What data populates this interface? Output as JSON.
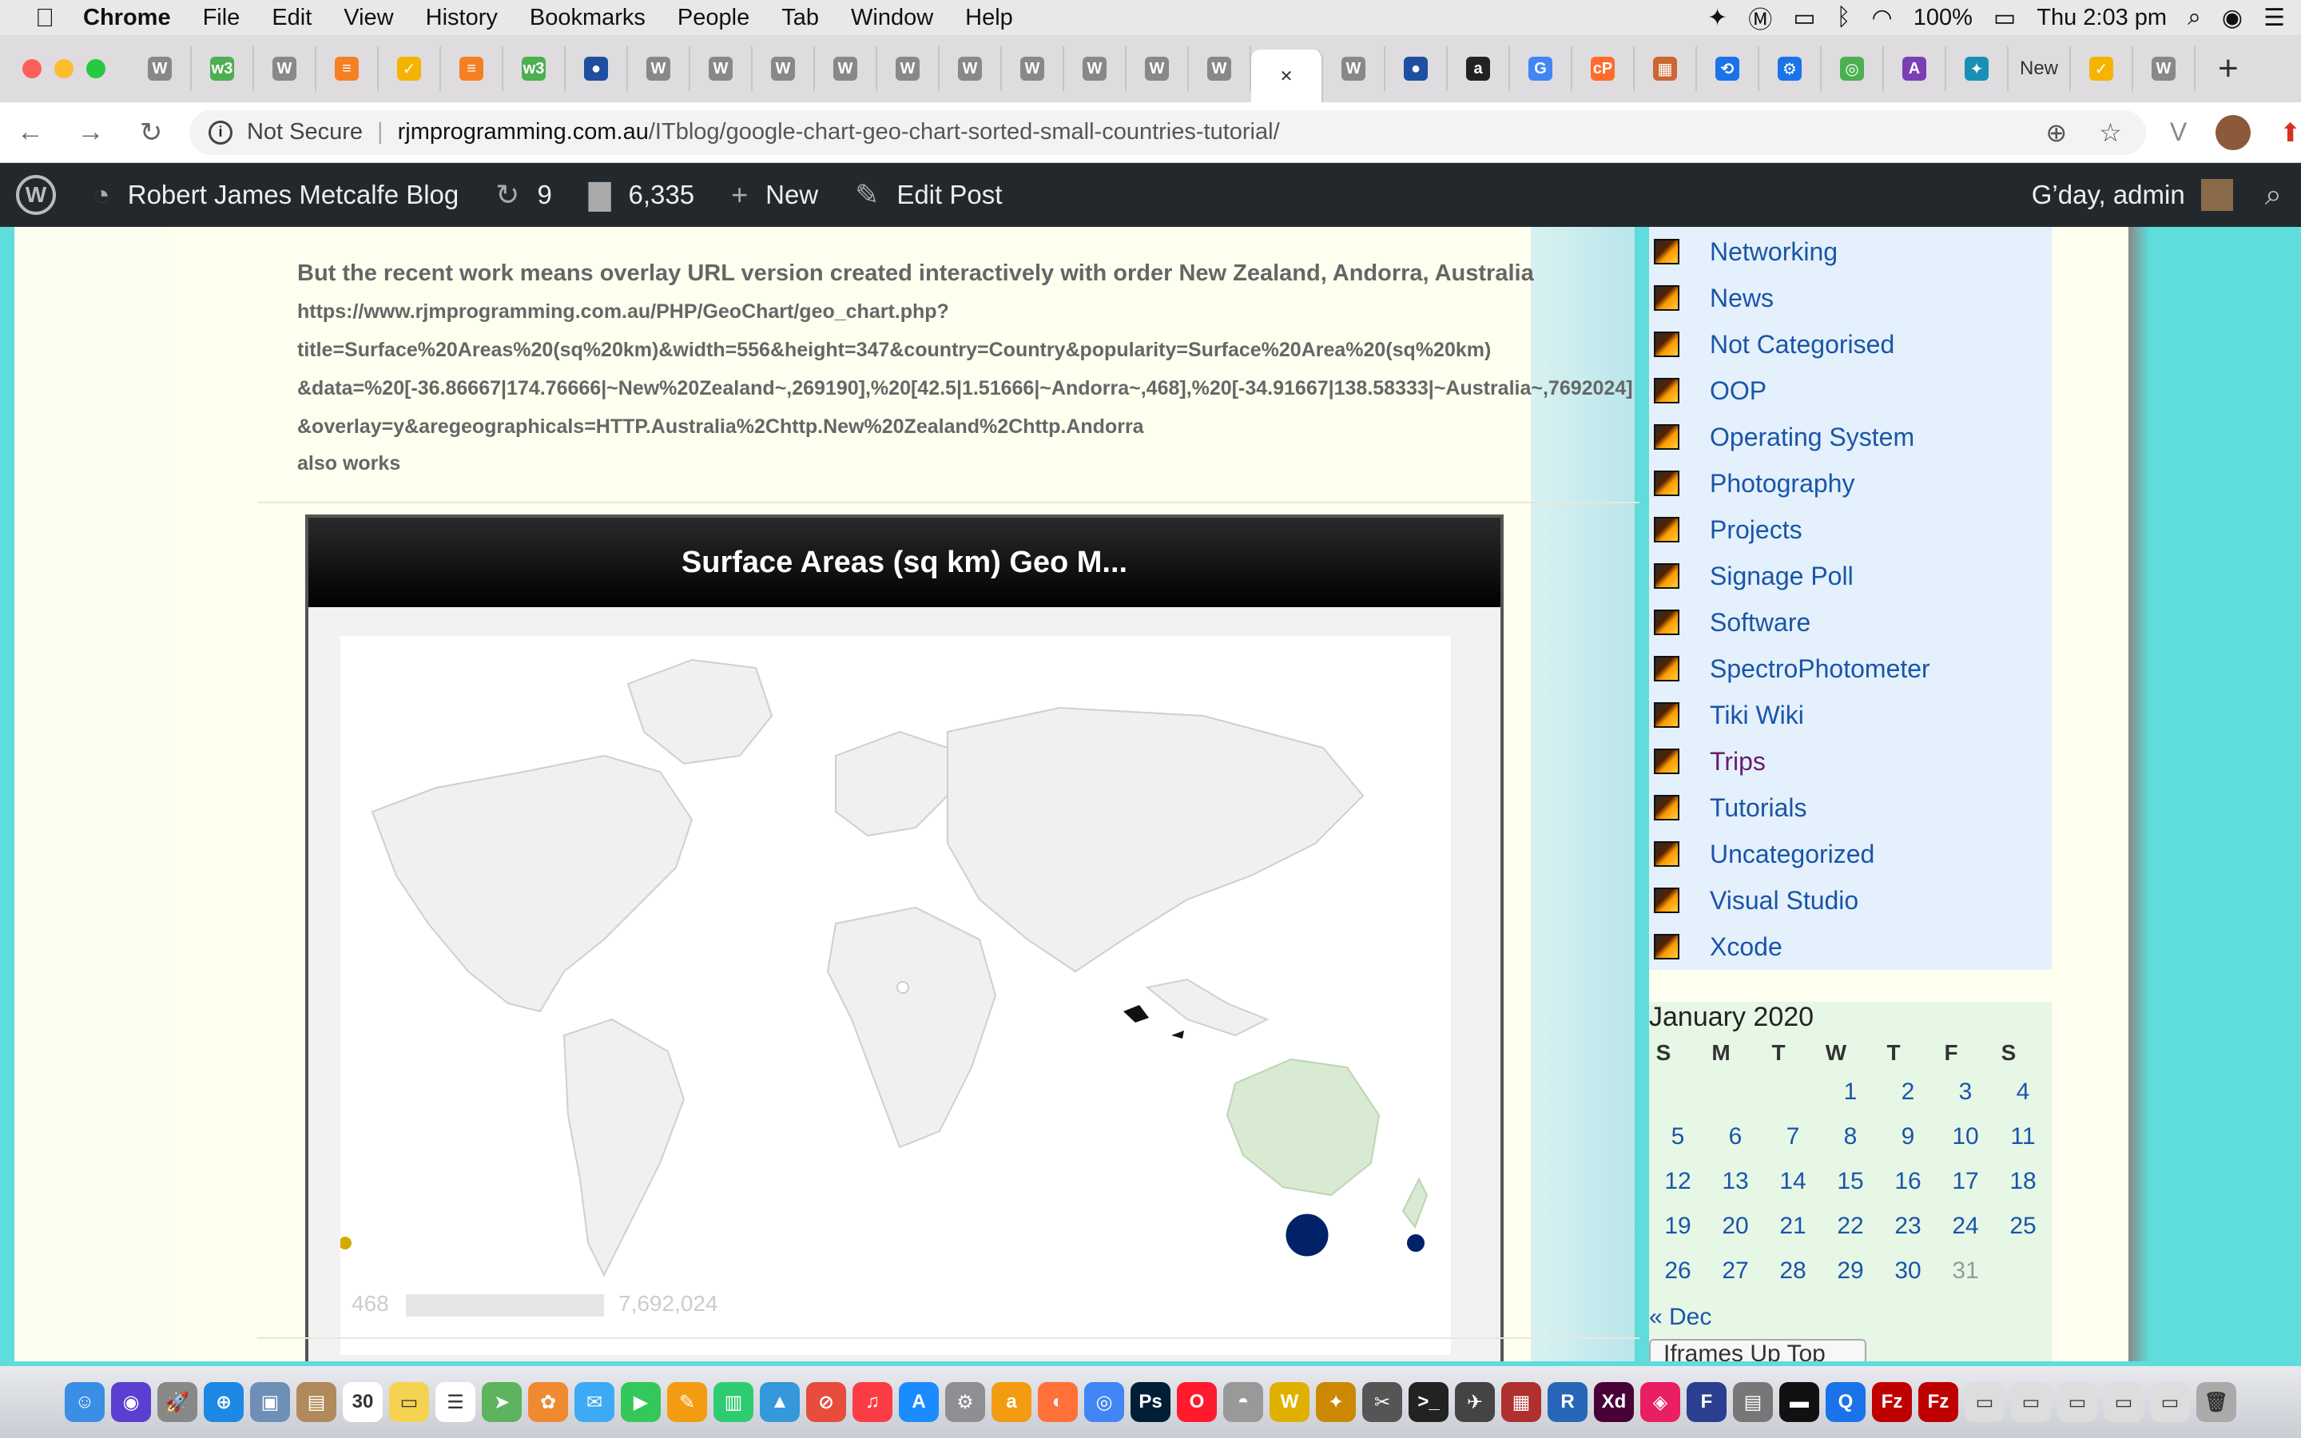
{
  "menubar": {
    "apple": "",
    "items": [
      "Chrome",
      "File",
      "Edit",
      "View",
      "History",
      "Bookmarks",
      "People",
      "Tab",
      "Window",
      "Help"
    ],
    "battery": "100%",
    "clock": "Thu 2:03 pm"
  },
  "tabs": {
    "new_tab_label": "+",
    "items": [
      {
        "icon": "wordpress-icon",
        "color": "#888888",
        "glyph": "W"
      },
      {
        "icon": "w3-icon",
        "color": "#4caf50",
        "glyph": "w3"
      },
      {
        "icon": "wordpress-icon",
        "color": "#888888",
        "glyph": "W"
      },
      {
        "icon": "stackoverflow-icon",
        "color": "#f48024",
        "glyph": "≡"
      },
      {
        "icon": "check-icon",
        "color": "#f5b400",
        "glyph": "✓"
      },
      {
        "icon": "stackoverflow-icon",
        "color": "#f48024",
        "glyph": "≡"
      },
      {
        "icon": "w3-icon",
        "color": "#4caf50",
        "glyph": "w3"
      },
      {
        "icon": "blue-circle-icon",
        "color": "#1e4fa0",
        "glyph": "●"
      },
      {
        "icon": "wordpress-icon",
        "color": "#888888",
        "glyph": "W"
      },
      {
        "icon": "wordpress-icon",
        "color": "#888888",
        "glyph": "W"
      },
      {
        "icon": "wordpress-icon",
        "color": "#888888",
        "glyph": "W"
      },
      {
        "icon": "wordpress-icon",
        "color": "#888888",
        "glyph": "W"
      },
      {
        "icon": "wordpress-icon",
        "color": "#888888",
        "glyph": "W"
      },
      {
        "icon": "wordpress-icon",
        "color": "#888888",
        "glyph": "W"
      },
      {
        "icon": "wordpress-icon",
        "color": "#888888",
        "glyph": "W"
      },
      {
        "icon": "wordpress-icon",
        "color": "#888888",
        "glyph": "W"
      },
      {
        "icon": "wordpress-icon",
        "color": "#888888",
        "glyph": "W"
      },
      {
        "icon": "wordpress-icon",
        "color": "#888888",
        "glyph": "W"
      },
      {
        "icon": "active-tab-close-icon",
        "color": "#ffffff",
        "glyph": "✕",
        "active": true
      },
      {
        "icon": "wordpress-icon",
        "color": "#888888",
        "glyph": "W"
      },
      {
        "icon": "blue-circle-icon",
        "color": "#1e4fa0",
        "glyph": "●"
      },
      {
        "icon": "amazon-icon",
        "color": "#222222",
        "glyph": "a"
      },
      {
        "icon": "google-icon",
        "color": "#4285f4",
        "glyph": "G"
      },
      {
        "icon": "cpanel-icon",
        "color": "#ff6c2c",
        "glyph": "cP"
      },
      {
        "icon": "image-icon",
        "color": "#cc6633",
        "glyph": "▦"
      },
      {
        "icon": "history-icon",
        "color": "#1a73e8",
        "glyph": "⟲"
      },
      {
        "icon": "settings-icon",
        "color": "#1a73e8",
        "glyph": "⚙"
      },
      {
        "icon": "green-app-icon",
        "color": "#4caf50",
        "glyph": "◎"
      },
      {
        "icon": "purple-app-icon",
        "color": "#7b3fb5",
        "glyph": "A"
      },
      {
        "icon": "bird-icon",
        "color": "#1a8fb5",
        "glyph": "✦"
      },
      {
        "icon": "text-tab-icon",
        "color": "#dedcdf",
        "glyph": "New"
      },
      {
        "icon": "check-icon",
        "color": "#f5b400",
        "glyph": "✓"
      },
      {
        "icon": "wordpress-icon",
        "color": "#888888",
        "glyph": "W"
      }
    ]
  },
  "omnibox": {
    "security_label": "Not Secure",
    "url_host": "rjmprogramming.com.au",
    "url_path": "/ITblog/google-chart-geo-chart-sorted-small-countries-tutorial/"
  },
  "adminbar": {
    "site_name": "Robert James Metcalfe Blog",
    "updates_count": "9",
    "comments_count": "6,335",
    "new_label": "New",
    "edit_label": "Edit Post",
    "greeting": "G’day, admin"
  },
  "post": {
    "heading": "But the recent work means overlay URL version created interactively with order New Zealand, Andorra, Australia",
    "url_lines": [
      "https://www.rjmprogramming.com.au/PHP/GeoChart/geo_chart.php?",
      "title=Surface%20Areas%20(sq%20km)&width=556&height=347&country=Country&popularity=Surface%20Area%20(sq%20km)",
      "&data=%20[-36.86667|174.76666|~New%20Zealand~,269190],%20[42.5|1.51666|~Andorra~,468],%20[-34.91667|138.58333|~Australia~,7692024]",
      "&overlay=y&aregeographicals=HTTP.Australia%2Chttp.New%20Zealand%2Chttp.Andorra"
    ],
    "also_works": "also works"
  },
  "chart_data": {
    "type": "geo",
    "title": "Surface Areas (sq km) Geo M...",
    "legend_min": "468",
    "legend_max": "7,692,024",
    "colors": {
      "shaded_country": "#d9ead3",
      "land": "#f0f0f0",
      "border": "#cfcfcf",
      "ocean": "#ffffff"
    }
  },
  "sidebar": {
    "categories": [
      {
        "label": "Networking"
      },
      {
        "label": "News"
      },
      {
        "label": "Not Categorised"
      },
      {
        "label": "OOP"
      },
      {
        "label": "Operating System"
      },
      {
        "label": "Photography"
      },
      {
        "label": "Projects"
      },
      {
        "label": "Signage Poll"
      },
      {
        "label": "Software"
      },
      {
        "label": "SpectroPhotometer"
      },
      {
        "label": "Tiki Wiki"
      },
      {
        "label": "Trips",
        "visited": true
      },
      {
        "label": "Tutorials"
      },
      {
        "label": "Uncategorized"
      },
      {
        "label": "Visual Studio"
      },
      {
        "label": "Xcode"
      }
    ],
    "calendar": {
      "title": "January 2020",
      "dow": [
        "S",
        "M",
        "T",
        "W",
        "T",
        "F",
        "S"
      ],
      "weeks": [
        [
          "",
          "",
          "",
          "1",
          "2",
          "3",
          "4"
        ],
        [
          "5",
          "6",
          "7",
          "8",
          "9",
          "10",
          "11"
        ],
        [
          "12",
          "13",
          "14",
          "15",
          "16",
          "17",
          "18"
        ],
        [
          "19",
          "20",
          "21",
          "22",
          "23",
          "24",
          "25"
        ],
        [
          "26",
          "27",
          "28",
          "29",
          "30",
          "31",
          ""
        ]
      ],
      "unlinked_days": [
        "31"
      ],
      "prev_label": "« Dec",
      "button_label": "Iframes Up Top"
    }
  },
  "dock": {
    "apps": [
      {
        "name": "finder-icon",
        "color": "#3a8ee6",
        "glyph": "☺"
      },
      {
        "name": "siri-icon",
        "color": "#5a3fd1",
        "glyph": "◉"
      },
      {
        "name": "launchpad-icon",
        "color": "#888888",
        "glyph": "🚀"
      },
      {
        "name": "safari-icon",
        "color": "#1e88e5",
        "glyph": "⊕"
      },
      {
        "name": "preview-icon",
        "color": "#6d8fb6",
        "glyph": "▣"
      },
      {
        "name": "contacts-icon",
        "color": "#b08a5a",
        "glyph": "▤"
      },
      {
        "name": "calendar-icon",
        "color": "#ffffff",
        "glyph": "30"
      },
      {
        "name": "notes-icon",
        "color": "#f5d251",
        "glyph": "▭"
      },
      {
        "name": "reminders-icon",
        "color": "#ffffff",
        "glyph": "☰"
      },
      {
        "name": "maps-icon",
        "color": "#5eb45e",
        "glyph": "➤"
      },
      {
        "name": "photos-icon",
        "color": "#f08a30",
        "glyph": "✿"
      },
      {
        "name": "messages-icon",
        "color": "#3ea9f5",
        "glyph": "✉"
      },
      {
        "name": "facetime-icon",
        "color": "#34c759",
        "glyph": "▶"
      },
      {
        "name": "pages-icon",
        "color": "#f39c12",
        "glyph": "✎"
      },
      {
        "name": "numbers-icon",
        "color": "#2ecc71",
        "glyph": "▥"
      },
      {
        "name": "keynote-icon",
        "color": "#3498db",
        "glyph": "▲"
      },
      {
        "name": "news-icon",
        "color": "#e74c3c",
        "glyph": "⊘"
      },
      {
        "name": "music-icon",
        "color": "#fc3c44",
        "glyph": "♫"
      },
      {
        "name": "appstore-icon",
        "color": "#1a8cff",
        "glyph": "A"
      },
      {
        "name": "system-preferences-icon",
        "color": "#8e8e93",
        "glyph": "⚙"
      },
      {
        "name": "app-icon",
        "color": "#f39c12",
        "glyph": "a"
      },
      {
        "name": "firefox-icon",
        "color": "#ff7139",
        "glyph": "◐"
      },
      {
        "name": "chrome-icon",
        "color": "#4285f4",
        "glyph": "◎"
      },
      {
        "name": "photoshop-icon",
        "color": "#001e36",
        "glyph": "Ps"
      },
      {
        "name": "opera-icon",
        "color": "#ff1b2d",
        "glyph": "O"
      },
      {
        "name": "elephant-icon",
        "color": "#999999",
        "glyph": "◓"
      },
      {
        "name": "app-icon",
        "color": "#e0b000",
        "glyph": "W"
      },
      {
        "name": "app-icon",
        "color": "#cc8800",
        "glyph": "✦"
      },
      {
        "name": "app-icon",
        "color": "#555555",
        "glyph": "✂"
      },
      {
        "name": "terminal-icon",
        "color": "#222222",
        "glyph": ">_"
      },
      {
        "name": "app-icon",
        "color": "#444444",
        "glyph": "✈"
      },
      {
        "name": "app-icon",
        "color": "#b03030",
        "glyph": "▦"
      },
      {
        "name": "r-icon",
        "color": "#2766b8",
        "glyph": "R"
      },
      {
        "name": "xd-icon",
        "color": "#470137",
        "glyph": "Xd"
      },
      {
        "name": "app-icon",
        "color": "#e91e63",
        "glyph": "◈"
      },
      {
        "name": "app-icon",
        "color": "#2c3e90",
        "glyph": "F"
      },
      {
        "name": "app-icon",
        "color": "#777777",
        "glyph": "▤"
      },
      {
        "name": "app-icon",
        "color": "#111111",
        "glyph": "▬"
      },
      {
        "name": "quicktime-icon",
        "color": "#1a73e8",
        "glyph": "Q"
      },
      {
        "name": "filezilla-icon",
        "color": "#bf0000",
        "glyph": "Fz"
      },
      {
        "name": "filezilla-icon",
        "color": "#bf0000",
        "glyph": "Fz"
      },
      {
        "name": "document-icon",
        "color": "#dddddd",
        "glyph": "▭"
      },
      {
        "name": "document-icon",
        "color": "#dddddd",
        "glyph": "▭"
      },
      {
        "name": "document-icon",
        "color": "#dddddd",
        "glyph": "▭"
      },
      {
        "name": "document-icon",
        "color": "#dddddd",
        "glyph": "▭"
      },
      {
        "name": "document-icon",
        "color": "#dddddd",
        "glyph": "▭"
      },
      {
        "name": "trash-icon",
        "color": "#aaaaaa",
        "glyph": "🗑"
      }
    ]
  }
}
